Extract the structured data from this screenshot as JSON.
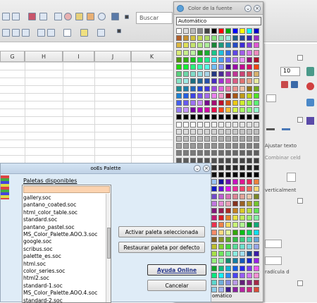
{
  "toolbar": {
    "search_placeholder": "Buscar"
  },
  "sheet": {
    "columns": [
      "G",
      "H",
      "I",
      "J",
      "K"
    ]
  },
  "sidebar": {
    "font_size": "10",
    "labels": [
      "Ajustar texto",
      "Combinar celd",
      "verticalment",
      "radícula d"
    ]
  },
  "font_color_panel": {
    "title": "Color de la fuente",
    "automatic_label": "Automático",
    "bottom_label": "omático"
  },
  "palette_dialog": {
    "title": "ooEs Palette",
    "available_label": "Paletas disponibles",
    "palettes": [
      "gallery.soc",
      "pantano_coated.soc",
      "html_color_table.soc",
      "standard.soc",
      "pantano_pastel.soc",
      "MS_Color_Palette.AOO.3.soc",
      "google.soc",
      "scribus.soc",
      "palette_es.soc",
      "html.soc",
      "color_series.soc",
      "html2.soc",
      "standard-1.soc",
      "MS_Color_Palette.AOO.4.soc",
      "standard-2.soc"
    ],
    "buttons": {
      "activate": "Activar paleta seleccionada",
      "restore": "Restaurar paleta por defecto",
      "help": "Ayuda Online",
      "cancel": "Cancelar"
    }
  }
}
